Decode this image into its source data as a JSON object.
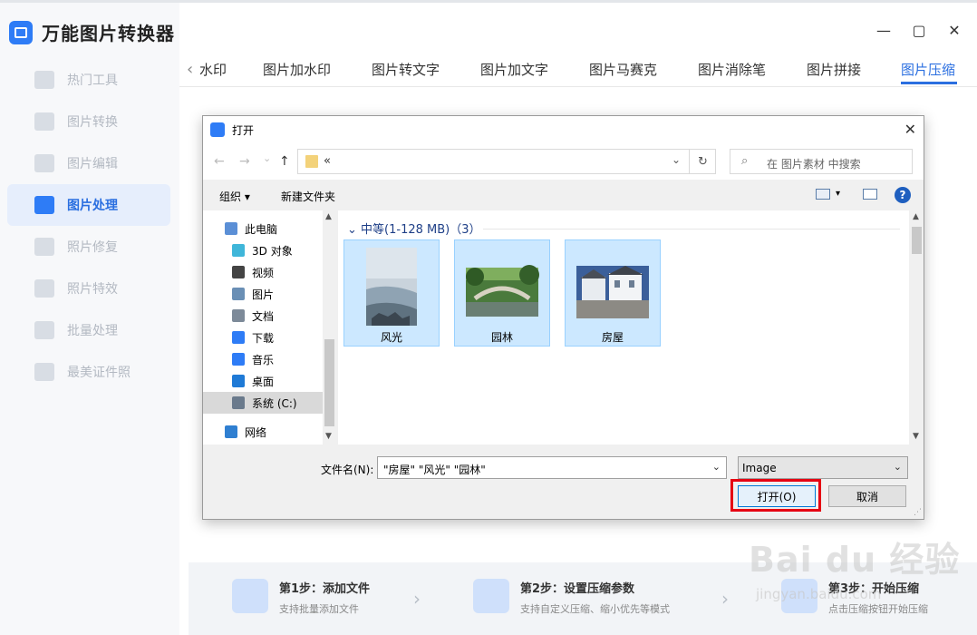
{
  "app": {
    "title": "万能图片转换器"
  },
  "window": {
    "minimize": "—",
    "maximize": "▢",
    "close": "✕"
  },
  "sidebar": {
    "items": [
      {
        "label": "热门工具",
        "active": false
      },
      {
        "label": "图片转换",
        "active": false
      },
      {
        "label": "图片编辑",
        "active": false
      },
      {
        "label": "图片处理",
        "active": true
      },
      {
        "label": "照片修复",
        "active": false
      },
      {
        "label": "照片特效",
        "active": false
      },
      {
        "label": "批量处理",
        "active": false
      },
      {
        "label": "最美证件照",
        "active": false
      }
    ]
  },
  "tabs": {
    "prev": "‹",
    "items": [
      "水印",
      "图片加水印",
      "图片转文字",
      "图片加文字",
      "图片马赛克",
      "图片消除笔",
      "图片拼接",
      "图片压缩"
    ],
    "active_index": 7
  },
  "steps": [
    {
      "title": "第1步：添加文件",
      "desc": "支持批量添加文件"
    },
    {
      "title": "第2步：设置压缩参数",
      "desc": "支持自定义压缩、缩小优先等模式"
    },
    {
      "title": "第3步：开始压缩",
      "desc": "点击压缩按钮开始压缩"
    }
  ],
  "dialog": {
    "title": "打开",
    "close": "✕",
    "nav": {
      "back": "←",
      "forward": "→",
      "recent": "⌄",
      "up": "↑"
    },
    "address": {
      "text": "«",
      "dropdown": "⌄",
      "refresh": "↻"
    },
    "search": {
      "placeholder": "在 图片素材 中搜索",
      "icon": "⌕"
    },
    "toolbar": {
      "organize": "组织 ▾",
      "new_folder": "新建文件夹",
      "view_dd": "▾",
      "help": "?"
    },
    "tree": [
      {
        "label": "此电脑",
        "color": "#5b8fd6",
        "indent": 0
      },
      {
        "label": "3D 对象",
        "color": "#3fb6d9",
        "indent": 1
      },
      {
        "label": "视频",
        "color": "#444444",
        "indent": 1
      },
      {
        "label": "图片",
        "color": "#6a8fb5",
        "indent": 1
      },
      {
        "label": "文档",
        "color": "#7d8a99",
        "indent": 1
      },
      {
        "label": "下载",
        "color": "#2e7cf6",
        "indent": 1
      },
      {
        "label": "音乐",
        "color": "#2e7cf6",
        "indent": 1
      },
      {
        "label": "桌面",
        "color": "#1f7ad6",
        "indent": 1
      },
      {
        "label": "系统 (C:)",
        "color": "#6a7a8c",
        "indent": 1,
        "selected": true
      },
      {
        "label": "网络",
        "color": "#2f7fd1",
        "indent": 0
      }
    ],
    "group": {
      "header": "中等(1-128 MB)（3）",
      "toggle": "⌄"
    },
    "files": [
      {
        "label": "风光"
      },
      {
        "label": "园林"
      },
      {
        "label": "房屋"
      }
    ],
    "filename": {
      "label": "文件名(N):",
      "value": "\"房屋\" \"风光\" \"园林\"",
      "dropdown": "⌄"
    },
    "filter": {
      "value": "Image",
      "dropdown": "⌄"
    },
    "buttons": {
      "open": "打开(O)",
      "cancel": "取消"
    }
  },
  "watermark": {
    "text": "Bai du 经验",
    "sub": "jingyan.baidu.com"
  }
}
